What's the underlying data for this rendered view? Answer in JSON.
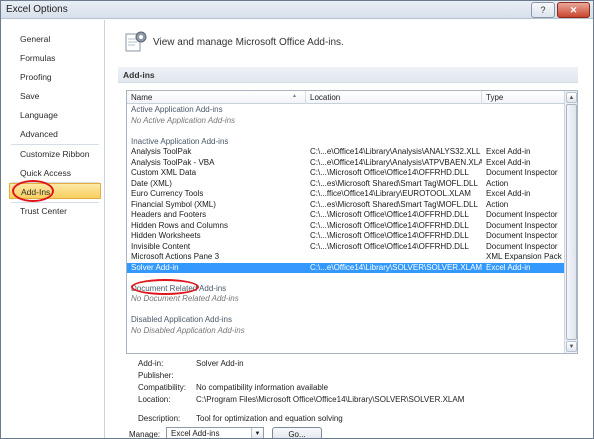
{
  "window": {
    "title": "Excel Options",
    "help_glyph": "?",
    "close_glyph": "✕"
  },
  "sidebar": {
    "items": [
      {
        "label": "General"
      },
      {
        "label": "Formulas"
      },
      {
        "label": "Proofing"
      },
      {
        "label": "Save"
      },
      {
        "label": "Language"
      },
      {
        "label": "Advanced"
      },
      {
        "label": "Customize Ribbon"
      },
      {
        "label": "Quick Access Toolbar"
      },
      {
        "label": "Add-Ins",
        "selected": true
      },
      {
        "label": "Trust Center"
      }
    ]
  },
  "header": {
    "text": "View and manage Microsoft Office Add-ins."
  },
  "section": {
    "title": "Add-ins"
  },
  "table": {
    "columns": [
      "Name",
      "Location",
      "Type"
    ],
    "sort_glyph": "▲",
    "rows": [
      {
        "kind": "group",
        "name": "Active Application Add-ins"
      },
      {
        "kind": "none",
        "name": "No Active Application Add-ins"
      },
      {
        "kind": "gap"
      },
      {
        "kind": "group",
        "name": "Inactive Application Add-ins"
      },
      {
        "kind": "item",
        "name": "Analysis ToolPak",
        "location": "C:\\...e\\Office14\\Library\\Analysis\\ANALYS32.XLL",
        "type": "Excel Add-in"
      },
      {
        "kind": "item",
        "name": "Analysis ToolPak - VBA",
        "location": "C:\\...e\\Office14\\Library\\Analysis\\ATPVBAEN.XLAM",
        "type": "Excel Add-in"
      },
      {
        "kind": "item",
        "name": "Custom XML Data",
        "location": "C:\\...\\Microsoft Office\\Office14\\OFFRHD.DLL",
        "type": "Document Inspector"
      },
      {
        "kind": "item",
        "name": "Date (XML)",
        "location": "C:\\...es\\Microsoft Shared\\Smart Tag\\MOFL.DLL",
        "type": "Action"
      },
      {
        "kind": "item",
        "name": "Euro Currency Tools",
        "location": "C:\\...ffice\\Office14\\Library\\EUROTOOL.XLAM",
        "type": "Excel Add-in"
      },
      {
        "kind": "item",
        "name": "Financial Symbol (XML)",
        "location": "C:\\...es\\Microsoft Shared\\Smart Tag\\MOFL.DLL",
        "type": "Action"
      },
      {
        "kind": "item",
        "name": "Headers and Footers",
        "location": "C:\\...\\Microsoft Office\\Office14\\OFFRHD.DLL",
        "type": "Document Inspector"
      },
      {
        "kind": "item",
        "name": "Hidden Rows and Columns",
        "location": "C:\\...\\Microsoft Office\\Office14\\OFFRHD.DLL",
        "type": "Document Inspector"
      },
      {
        "kind": "item",
        "name": "Hidden Worksheets",
        "location": "C:\\...\\Microsoft Office\\Office14\\OFFRHD.DLL",
        "type": "Document Inspector"
      },
      {
        "kind": "item",
        "name": "Invisible Content",
        "location": "C:\\...\\Microsoft Office\\Office14\\OFFRHD.DLL",
        "type": "Document Inspector"
      },
      {
        "kind": "item",
        "name": "Microsoft Actions Pane 3",
        "location": "",
        "type": "XML Expansion Pack"
      },
      {
        "kind": "item",
        "name": "Solver Add-in",
        "location": "C:\\...e\\Office14\\Library\\SOLVER\\SOLVER.XLAM",
        "type": "Excel Add-in",
        "selected": true
      },
      {
        "kind": "gap"
      },
      {
        "kind": "group",
        "name": "Document Related Add-ins"
      },
      {
        "kind": "none",
        "name": "No Document Related Add-ins"
      },
      {
        "kind": "gap"
      },
      {
        "kind": "group",
        "name": "Disabled Application Add-ins"
      },
      {
        "kind": "none",
        "name": "No Disabled Application Add-ins"
      }
    ]
  },
  "scrollbar": {
    "up_glyph": "▲",
    "down_glyph": "▼"
  },
  "details": [
    {
      "label": "Add-in:",
      "value": "Solver Add-in"
    },
    {
      "label": "Publisher:",
      "value": ""
    },
    {
      "label": "Compatibility:",
      "value": "No compatibility information available"
    },
    {
      "label": "Location:",
      "value": "C:\\Program Files\\Microsoft Office\\Office14\\Library\\SOLVER\\SOLVER.XLAM"
    },
    {
      "label": "Description:",
      "value": "Tool for optimization and equation solving"
    }
  ],
  "manage": {
    "label": "Manage:",
    "value": "Excel Add-ins",
    "dropdown_glyph": "▼",
    "go_label": "Go..."
  },
  "colors": {
    "selection": "#3399ff",
    "nav_selected": "#f9cf5f",
    "highlight_ring": "#e0151b"
  }
}
